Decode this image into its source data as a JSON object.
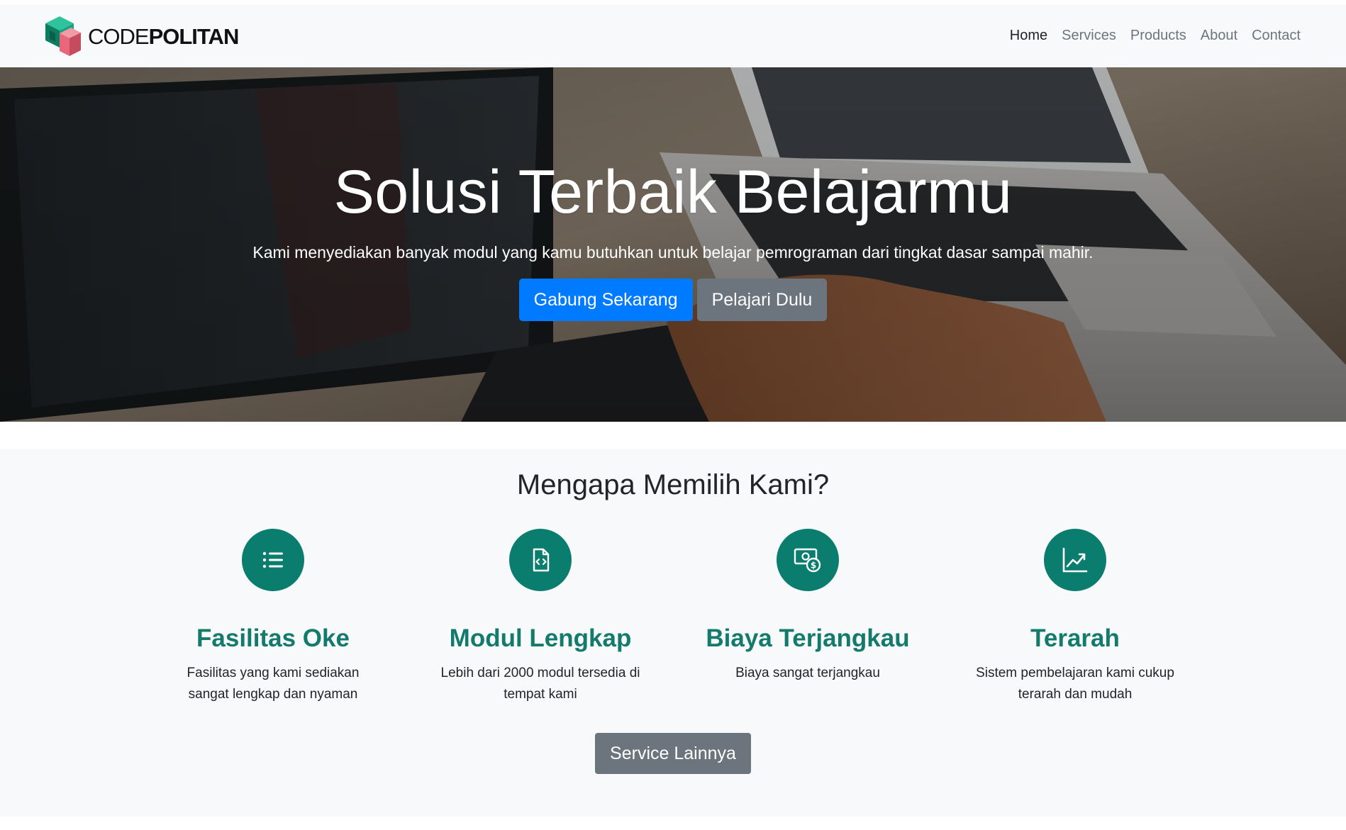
{
  "navbar": {
    "brand": {
      "light": "CODE",
      "bold": "POLITAN"
    },
    "links": [
      "Home",
      "Services",
      "Products",
      "About",
      "Contact"
    ],
    "active": "Home"
  },
  "hero": {
    "title": "Solusi Terbaik Belajarmu",
    "lead": "Kami menyediakan banyak modul yang kamu butuhkan untuk belajar pemrograman dari tingkat dasar sampai mahir.",
    "primary_button": "Gabung Sekarang",
    "secondary_button": "Pelajari Dulu"
  },
  "features": {
    "title": "Mengapa Memilih Kami?",
    "items": [
      {
        "icon": "list-icon",
        "title": "Fasilitas Oke",
        "desc": "Fasilitas yang kami sediakan sangat lengkap dan nyaman"
      },
      {
        "icon": "code-file-icon",
        "title": "Modul Lengkap",
        "desc": "Lebih dari 2000 modul tersedia di tempat kami"
      },
      {
        "icon": "money-icon",
        "title": "Biaya Terjangkau",
        "desc": "Biaya sangat terjangkau"
      },
      {
        "icon": "chart-up-icon",
        "title": "Terarah",
        "desc": "Sistem pembelajaran kami cukup terarah dan mudah"
      }
    ],
    "more_button": "Service Lainnya"
  },
  "colors": {
    "primary": "#007bff",
    "secondary": "#6c757d",
    "accent": "#0b7d6f",
    "feature_title": "#137a6c"
  }
}
